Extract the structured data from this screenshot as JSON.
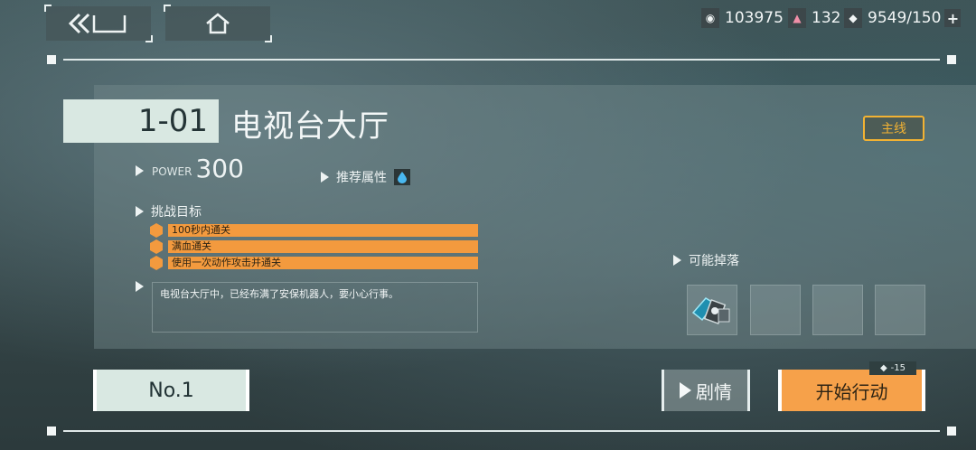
{
  "topbar": {
    "back_icon": "double-chevron-left-icon",
    "home_icon": "home-icon",
    "resources": [
      {
        "icon": "coin-icon",
        "value": "103975"
      },
      {
        "icon": "crystal-icon",
        "value": "132"
      },
      {
        "icon": "stamina-ticket-icon",
        "value": "9549/150"
      }
    ],
    "add_label": "+"
  },
  "stage": {
    "number": "1-01",
    "name": "电视台大厅",
    "badge": "主线",
    "power_label": "POWER",
    "power_value": "300",
    "recommend_label": "推荐属性",
    "recommend_icon": "water-drop-icon",
    "objectives_label": "挑战目标",
    "objectives": [
      "100秒内通关",
      "满血通关",
      "使用一次动作攻击并通关"
    ],
    "description": "电视台大厅中，已经布满了安保机器人，要小心行事。",
    "drops_label": "可能掉落"
  },
  "actions": {
    "no1_label": "No.1",
    "story_label": "剧情",
    "start_label": "开始行动",
    "cost": "-15"
  },
  "colors": {
    "accent_orange": "#f39a3e",
    "badge_gold": "#f2b233",
    "panel_mint": "#d9e8e2"
  }
}
